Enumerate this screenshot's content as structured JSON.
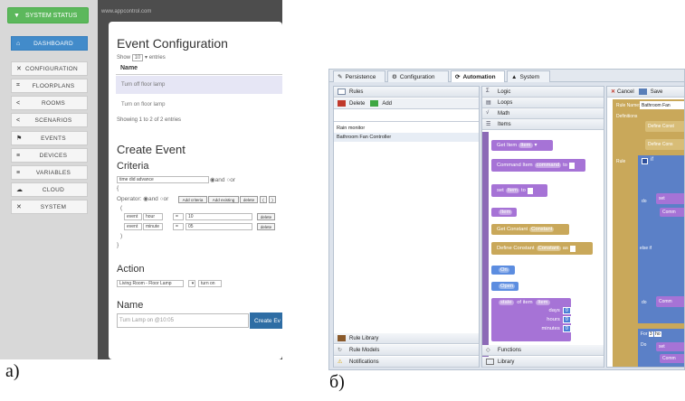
{
  "panel_a": {
    "caption": "a)",
    "system_status": "SYSTEM STATUS",
    "url": "www.appcontrol.com",
    "sidebar": [
      {
        "label": "DASHBOARD",
        "icon": "home-icon",
        "glyph": "⌂",
        "active": true
      },
      {
        "label": "CONFIGURATION",
        "icon": "wrench-icon",
        "glyph": "✕",
        "active": false
      },
      {
        "label": "FLOORPLANS",
        "icon": "floorplan-icon",
        "glyph": "⌗",
        "active": false
      },
      {
        "label": "ROOMS",
        "icon": "share-icon",
        "glyph": "<",
        "active": false
      },
      {
        "label": "SCENARIOS",
        "icon": "share-icon",
        "glyph": "<",
        "active": false
      },
      {
        "label": "EVENTS",
        "icon": "flag-icon",
        "glyph": "⚑",
        "active": false
      },
      {
        "label": "DEVICES",
        "icon": "list-icon",
        "glyph": "≡",
        "active": false
      },
      {
        "label": "VARIABLES",
        "icon": "list-icon",
        "glyph": "≡",
        "active": false
      },
      {
        "label": "CLOUD",
        "icon": "cloud-icon",
        "glyph": "☁",
        "active": false
      },
      {
        "label": "SYSTEM",
        "icon": "wrench-icon",
        "glyph": "✕",
        "active": false
      }
    ],
    "event_config": {
      "title": "Event Configuration",
      "show_prefix": "Show",
      "show_value": "10",
      "show_suffix": "entries",
      "col_name": "Name",
      "rows": [
        "Turn off floor lamp",
        "Turn on floor lamp"
      ],
      "info": "Showing 1 to 2 of 2 entries"
    },
    "create_event": {
      "title": "Create Event",
      "criteria_title": "Criteria",
      "criteria_select": "time did advance",
      "and_label": "and",
      "or_label": "or",
      "brace_open": "{",
      "brace_close": "}",
      "operator_label": "Operator:",
      "add_criteria": "Add criteria",
      "add_existing": "Add existing",
      "delete": "delete",
      "bracket_open": "(",
      "bracket_next": ")",
      "paren_open": "(",
      "paren_close": ")",
      "criteria_rows": [
        {
          "a": "event",
          "b": "hour",
          "op": "=",
          "val": "10",
          "del": "delete"
        },
        {
          "a": "event",
          "b": "minute",
          "op": "=",
          "val": "05",
          "del": "delete"
        }
      ],
      "action_title": "Action",
      "action_device": "Living Room - Floor Lamp",
      "action_cmd": "turn on",
      "name_title": "Name",
      "name_value": "Turn Lamp on @10:05",
      "create_button": "Create Ev"
    }
  },
  "panel_b": {
    "caption": "б)",
    "tabs": [
      {
        "label": "Persistence",
        "icon": "persistence-icon",
        "glyph": "✎"
      },
      {
        "label": "Configuration",
        "icon": "configuration-icon",
        "glyph": "⚙"
      },
      {
        "label": "Automation",
        "icon": "automation-icon",
        "glyph": "⟳",
        "active": true
      },
      {
        "label": "System",
        "icon": "system-icon",
        "glyph": "▲"
      }
    ],
    "rules_header": "Rules",
    "delete_label": "Delete",
    "add_label": "Add",
    "rules": [
      "Rain monitor",
      "Bathroom Fan Controller"
    ],
    "bottom_items": [
      "Rule Library",
      "Rule Models",
      "Notifications"
    ],
    "palette": [
      "Logic",
      "Loops",
      "Math",
      "Items"
    ],
    "palette_bottom": [
      "Functions",
      "Library"
    ],
    "blocks": {
      "get_item": "Get Item",
      "item_dd": "Item",
      "command_item": "Command Item",
      "command_dd": "command",
      "to": "to",
      "set": "set",
      "item_dd2": "Item",
      "item_block": "Item",
      "get_constant": "Get Constant",
      "constant_dd": "Constant",
      "define_constant": "Define Constant",
      "constant_dd2": "Constant",
      "as": "as",
      "on_dd": "On",
      "open_dd": "Open",
      "state_dd": "state",
      "of_item": "of item",
      "item_dd3": "Item",
      "days": "days",
      "hours": "hours",
      "minutes": "minutes",
      "zero": "0"
    },
    "editor": {
      "cancel": "Cancel",
      "save": "Save",
      "rule_name_label": "Rule Name:",
      "rule_name_value": "Bathroom Fan",
      "definitions": "Definitions",
      "define_const1": "Define Const",
      "define_const2": "Define Cons",
      "rule": "Rule",
      "if": "if",
      "do": "do",
      "else_if": "else if",
      "set": "set",
      "comm": "Comm",
      "for": "For",
      "for_val": "3",
      "ho": "ho",
      "do2": "Do"
    }
  }
}
